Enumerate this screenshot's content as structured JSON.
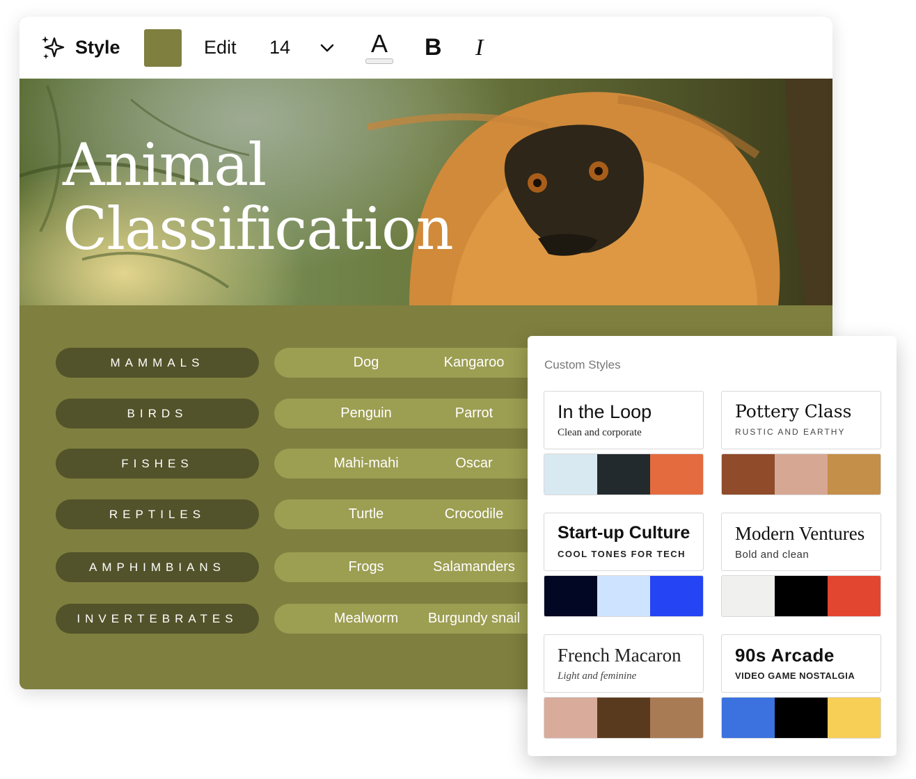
{
  "toolbar": {
    "style_label": "Style",
    "color_swatch": "#7f7f3f",
    "edit_label": "Edit",
    "font_size": "14",
    "text_color_glyph": "A",
    "bold_glyph": "B",
    "italic_glyph": "I"
  },
  "hero": {
    "title_line1": "Animal",
    "title_line2": "Classification"
  },
  "classification": [
    {
      "category": "MAMMALS",
      "examples": [
        "Dog",
        "Kangaroo"
      ]
    },
    {
      "category": "BIRDS",
      "examples": [
        "Penguin",
        "Parrot"
      ]
    },
    {
      "category": "FISHES",
      "examples": [
        "Mahi-mahi",
        "Oscar"
      ]
    },
    {
      "category": "REPTILES",
      "examples": [
        "Turtle",
        "Crocodile"
      ]
    },
    {
      "category": "AMPHIMBIANS",
      "examples": [
        "Frogs",
        "Salamanders"
      ]
    },
    {
      "category": "INVERTEBRATES",
      "examples": [
        "Mealworm",
        "Burgundy snail"
      ]
    }
  ],
  "custom_styles": {
    "title": "Custom Styles",
    "items": [
      {
        "name": "In the Loop",
        "subtitle": "Clean and corporate",
        "palette": [
          "#d8e9f1",
          "#232a2d",
          "#e46b3e"
        ]
      },
      {
        "name": "Pottery Class",
        "subtitle": "RUSTIC AND EARTHY",
        "palette": [
          "#8f4b2a",
          "#d6a793",
          "#c48f48"
        ]
      },
      {
        "name": "Start-up Culture",
        "subtitle": "COOL TONES FOR TECH",
        "palette": [
          "#020823",
          "#cde3ff",
          "#2544f3"
        ]
      },
      {
        "name": "Modern Ventures",
        "subtitle": "Bold and clean",
        "palette": [
          "#f0f0ee",
          "#000000",
          "#e24630"
        ]
      },
      {
        "name": "French Macaron",
        "subtitle": "Light and feminine",
        "palette": [
          "#d9ab9b",
          "#5a3a1e",
          "#a97b54"
        ]
      },
      {
        "name": "90s Arcade",
        "subtitle": "VIDEO GAME NOSTALGIA",
        "palette": [
          "#3b72df",
          "#000000",
          "#f7ce56"
        ]
      }
    ]
  }
}
